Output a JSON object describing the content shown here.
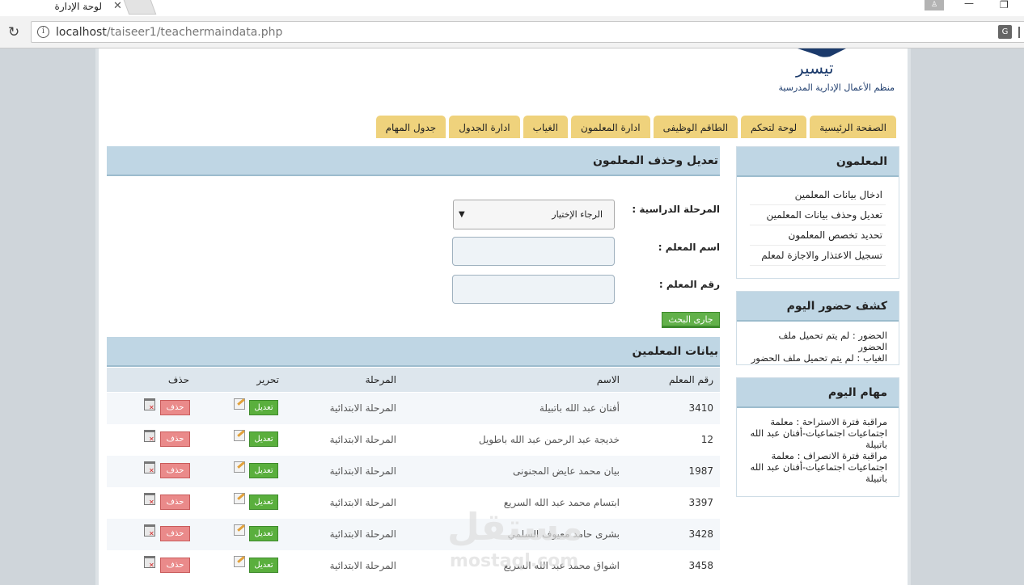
{
  "browser": {
    "tab_title": "لوحة الإدارة",
    "tab_close": "✕",
    "url_host": "localhost",
    "url_path": "/taiseer1/teachermaindata.php",
    "min": "—",
    "restore": "❐"
  },
  "site": {
    "logo_name": "تيسير",
    "logo_tagline": "منظم الأعمال الإدارية المدرسية"
  },
  "nav": [
    {
      "label": "الصفحة الرئيسية"
    },
    {
      "label": "لوحة لتحكم"
    },
    {
      "label": "الطاقم الوظيفى"
    },
    {
      "label": "ادارة المعلمون"
    },
    {
      "label": "الغياب"
    },
    {
      "label": "ادارة الجدول"
    },
    {
      "label": "جدول المهام"
    }
  ],
  "sidebar": {
    "teachers": {
      "title": "المعلمون",
      "links": [
        "ادخال بيانات المعلمين",
        "تعديل وحذف بيانات المعلمين",
        "تحديد تخصص المعلمون",
        "تسجيل الاعتذار والاجازة لمعلم"
      ]
    },
    "attendance": {
      "title": "كشف حضور اليوم",
      "line1": "الحضور : لم يتم تحميل ملف الحضور",
      "line2": "الغياب : لم يتم تحميل ملف الحضور"
    },
    "tasks": {
      "title": "مهام اليوم",
      "line1": "مراقبة فترة الاستراحة : معلمة اجتماعيات اجتماعيات-أفنان عبد الله باتبيلة",
      "line2": "مراقبة فترة الانصراف : معلمة اجتماعيات اجتماعيات-أفنان عبد الله باتبيلة"
    }
  },
  "form": {
    "title": "تعديل وحذف المعلمون",
    "stage_label": "المرحلة الدراسية :",
    "stage_value": "الرجاء الإختيار",
    "name_label": "اسم المعلم :",
    "number_label": "رقم المعلم :",
    "search_button": "جارى البحث"
  },
  "table": {
    "title": "بيانات المعلمين",
    "headers": {
      "number": "رقم المعلم",
      "name": "الاسم",
      "stage": "المرحلة",
      "edit": "تحرير",
      "delete": "حذف"
    },
    "edit_label": "تعديل",
    "delete_label": "حذف",
    "rows": [
      {
        "number": "3410",
        "name": "أفنان عبد الله باتبيلة",
        "stage": "المرحلة الابتدائية"
      },
      {
        "number": "12",
        "name": "خديجة عبد الرحمن عبد الله باطويل",
        "stage": "المرحلة الابتدائية"
      },
      {
        "number": "1987",
        "name": "بيان محمد عايض المجنونى",
        "stage": "المرحلة الابتدائية"
      },
      {
        "number": "3397",
        "name": "ابتسام محمد عبد الله السريع",
        "stage": "المرحلة الابتدائية"
      },
      {
        "number": "3428",
        "name": "بشرى حامد معيوف السلمي",
        "stage": "المرحلة الابتدائية"
      },
      {
        "number": "3458",
        "name": "اشواق محمد عبد الله السريع",
        "stage": "المرحلة الابتدائية"
      }
    ]
  },
  "watermark": {
    "arabic": "مستقل",
    "latin": "mostaql.com"
  },
  "colors": {
    "nav_tab": "#efd27c",
    "panel_head": "#bfd6e4",
    "edit_button": "#5aaf3d",
    "delete_button": "#ea8a8a"
  }
}
